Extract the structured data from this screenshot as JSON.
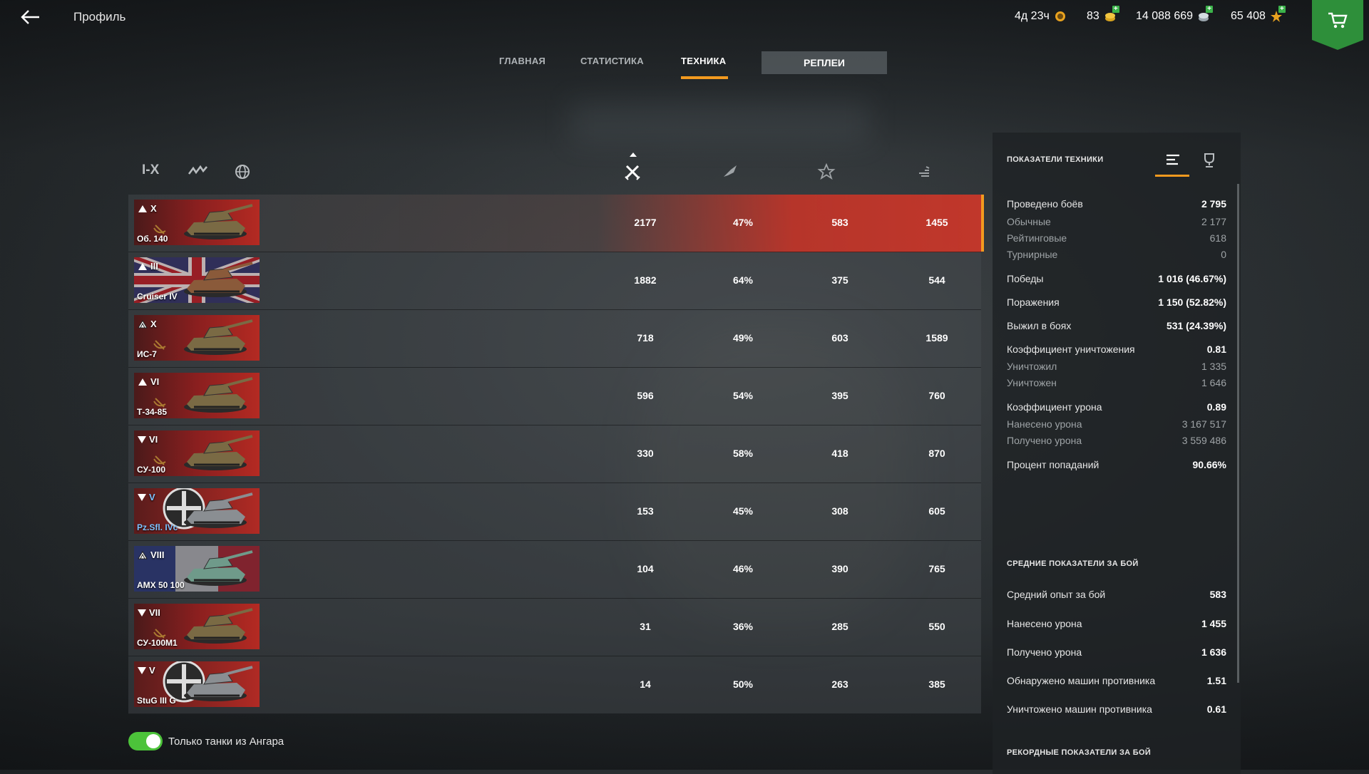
{
  "header": {
    "title": "Профиль",
    "resources": [
      {
        "name": "premium-time",
        "value": "4д 23ч",
        "icon": "premium-clock-icon"
      },
      {
        "name": "gold",
        "value": "83",
        "icon": "gold-coins-icon"
      },
      {
        "name": "credits",
        "value": "14 088 669",
        "icon": "credits-icon"
      },
      {
        "name": "free-xp",
        "value": "65 408",
        "icon": "free-xp-star-icon"
      }
    ]
  },
  "tabs": [
    "ГЛАВНАЯ",
    "СТАТИСТИКА",
    "ТЕХНИКА",
    "РЕПЛЕИ"
  ],
  "filters": {
    "tier": "I-X"
  },
  "tanks": [
    {
      "tier": "X",
      "name": "Об. 140",
      "battles": "2177",
      "winrate": "47%",
      "xp": "583",
      "damage": "1455",
      "nation": "ussr",
      "type": "medium"
    },
    {
      "tier": "III",
      "name": "Cruiser IV",
      "battles": "1882",
      "winrate": "64%",
      "xp": "375",
      "damage": "544",
      "nation": "uk",
      "type": "medium"
    },
    {
      "tier": "X",
      "name": "ИС-7",
      "battles": "718",
      "winrate": "49%",
      "xp": "603",
      "damage": "1589",
      "nation": "ussr",
      "type": "heavy"
    },
    {
      "tier": "VI",
      "name": "Т-34-85",
      "battles": "596",
      "winrate": "54%",
      "xp": "395",
      "damage": "760",
      "nation": "ussr",
      "type": "medium"
    },
    {
      "tier": "VI",
      "name": "СУ-100",
      "battles": "330",
      "winrate": "58%",
      "xp": "418",
      "damage": "870",
      "nation": "ussr",
      "type": "td"
    },
    {
      "tier": "V",
      "name": "Pz.Sfl. IVc",
      "battles": "153",
      "winrate": "45%",
      "xp": "308",
      "damage": "605",
      "nation": "germany",
      "type": "td"
    },
    {
      "tier": "VIII",
      "name": "AMX 50 100",
      "battles": "104",
      "winrate": "46%",
      "xp": "390",
      "damage": "765",
      "nation": "france",
      "type": "heavy"
    },
    {
      "tier": "VII",
      "name": "СУ-100М1",
      "battles": "31",
      "winrate": "36%",
      "xp": "285",
      "damage": "550",
      "nation": "ussr",
      "type": "td"
    },
    {
      "tier": "V",
      "name": "StuG III G",
      "battles": "14",
      "winrate": "50%",
      "xp": "263",
      "damage": "385",
      "nation": "germany",
      "type": "td"
    }
  ],
  "toggle": {
    "label": "Только танки из Ангара",
    "on": true
  },
  "panel": {
    "title": "ПОКАЗАТЕЛИ ТЕХНИКИ",
    "stats": [
      {
        "k": "Проведено боёв",
        "v": "2 795"
      },
      {
        "k": "Обычные",
        "v": "2 177",
        "sub": true
      },
      {
        "k": "Рейтинговые",
        "v": "618",
        "sub": true
      },
      {
        "k": "Турнирные",
        "v": "0",
        "sub": true
      },
      {
        "k": "Победы",
        "v": "1 016 (46.67%)"
      },
      {
        "k": "Поражения",
        "v": "1 150 (52.82%)"
      },
      {
        "k": "Выжил в боях",
        "v": "531 (24.39%)"
      },
      {
        "k": "Коэффициент уничтожения",
        "v": "0.81"
      },
      {
        "k": "Уничтожил",
        "v": "1 335",
        "sub": true
      },
      {
        "k": "Уничтожен",
        "v": "1 646",
        "sub": true
      },
      {
        "k": "Коэффициент урона",
        "v": "0.89"
      },
      {
        "k": "Нанесено урона",
        "v": "3 167 517",
        "sub": true
      },
      {
        "k": "Получено урона",
        "v": "3 559 486",
        "sub": true
      },
      {
        "k": "Процент попаданий",
        "v": "90.66%"
      }
    ],
    "avg_title": "СРЕДНИЕ ПОКАЗАТЕЛИ ЗА БОЙ",
    "avg_stats": [
      {
        "k": "Средний опыт за бой",
        "v": "583"
      },
      {
        "k": "Нанесено урона",
        "v": "1 455"
      },
      {
        "k": "Получено урона",
        "v": "1 636"
      },
      {
        "k": "Обнаружено машин противника",
        "v": "1.51"
      },
      {
        "k": "Уничтожено машин противника",
        "v": "0.61"
      }
    ],
    "record_title": "РЕКОРДНЫЕ ПОКАЗАТЕЛИ ЗА БОЙ"
  },
  "colors": {
    "accent": "#f39a1f",
    "toggle": "#4cc33a",
    "highlight": "#c8372a",
    "shop": "#2e8f3a"
  }
}
